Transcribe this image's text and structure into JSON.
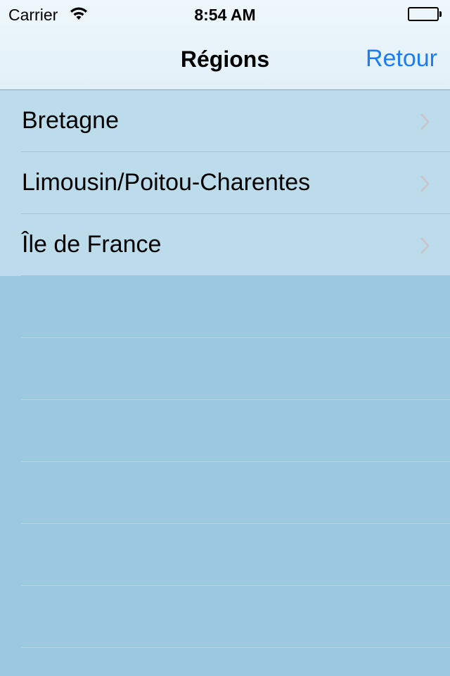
{
  "status_bar": {
    "carrier": "Carrier",
    "time": "8:54 AM",
    "wifi_icon": "wifi-icon",
    "battery_icon": "battery-icon"
  },
  "nav": {
    "title": "Régions",
    "back_label": "Retour"
  },
  "regions": [
    {
      "label": "Bretagne"
    },
    {
      "label": "Limousin/Poitou-Charentes"
    },
    {
      "label": "Île de France"
    }
  ],
  "colors": {
    "accent": "#1a7df5",
    "row_background": "#bcdceb",
    "table_background": "#9dc9e0",
    "chevron": "#c7c7cc"
  }
}
